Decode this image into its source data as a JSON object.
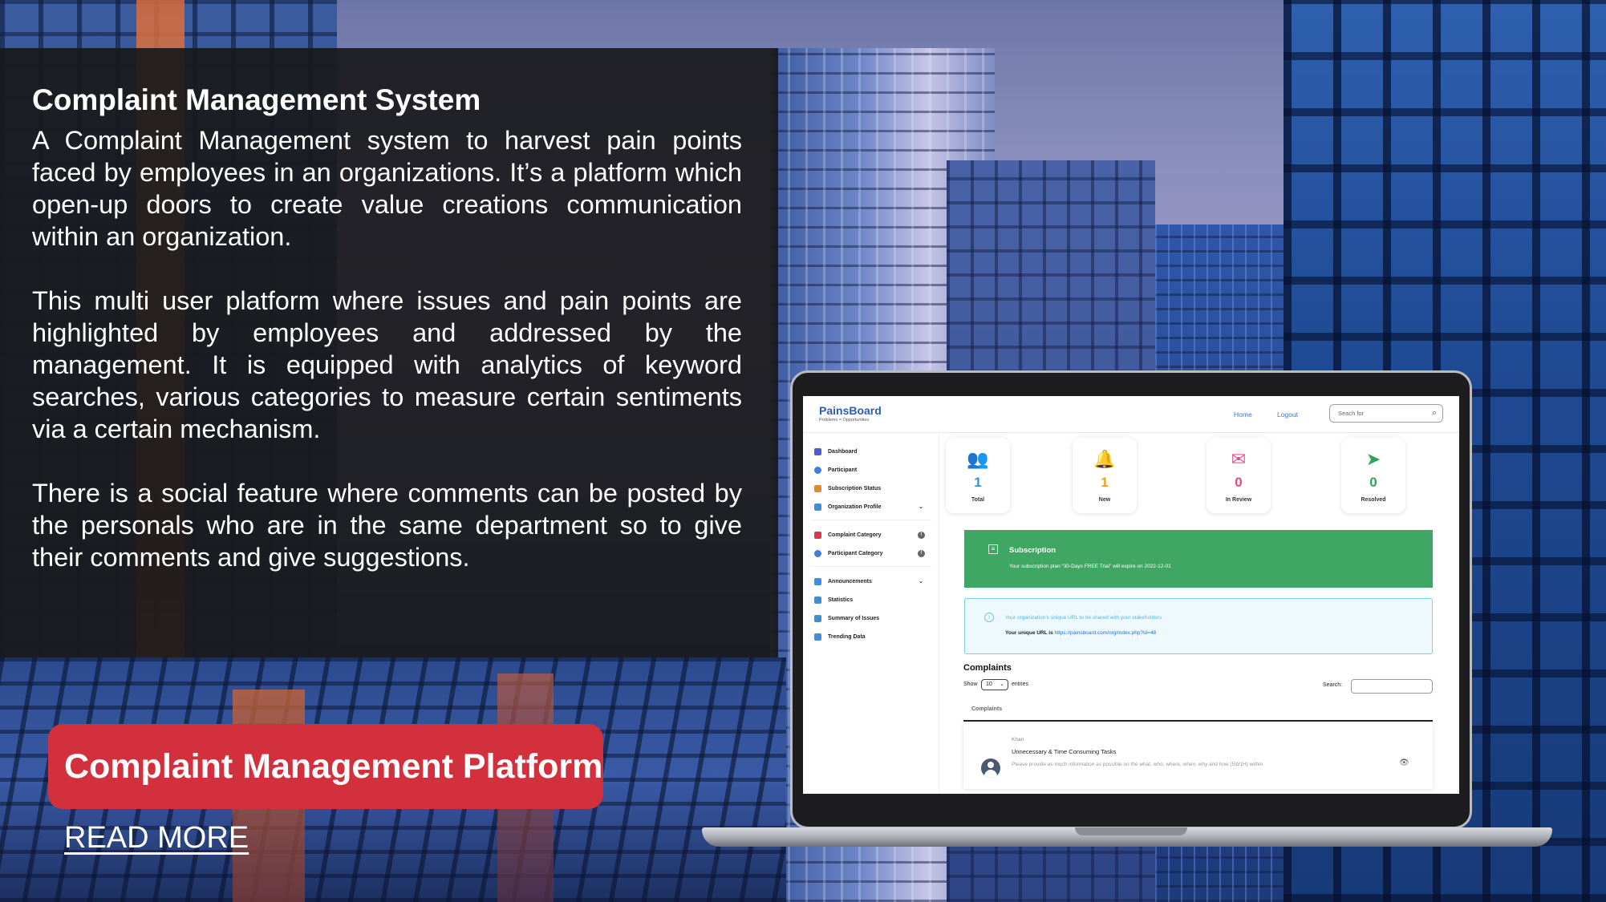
{
  "panel": {
    "title": "Complaint Management System",
    "paragraphs": [
      "A Complaint Management system to harvest pain points faced by employees in an organizations. It’s a platform which open-up doors to create value creations communication within an organization.",
      "This multi user platform where issues and pain points are highlighted by employees and addressed by the management. It is equipped with analytics of keyword searches, various categories to measure certain sentiments via a certain mechanism.",
      "There is a social feature where comments can be posted by the personals who are in the same department so to give their comments and give suggestions."
    ]
  },
  "cta": {
    "label": "Complaint Management Platform",
    "read_more": "READ MORE"
  },
  "app": {
    "logo": "PainsBoard",
    "logo_tagline": "Problems = Opportunities",
    "nav": {
      "home": "Home",
      "logout": "Logout"
    },
    "search_placeholder": "Seach for",
    "sidebar": [
      {
        "label": "Dashboard",
        "icon": "home-icon",
        "color": "#4a5fd0"
      },
      {
        "label": "Participant",
        "icon": "user-icon",
        "color": "#3f7fd4"
      },
      {
        "label": "Subscription Status",
        "icon": "clipboard-icon",
        "color": "#e08a2c"
      },
      {
        "label": "Organization Profile",
        "icon": "building-icon",
        "color": "#3f8fd4"
      },
      {
        "label": "Complaint Category",
        "icon": "folder-icon",
        "color": "#d83a4a"
      },
      {
        "label": "Participant Category",
        "icon": "user-group-icon",
        "color": "#3f7fd4"
      },
      {
        "label": "Announcements",
        "icon": "megaphone-icon",
        "color": "#3f8fd4"
      },
      {
        "label": "Statistics",
        "icon": "bar-chart-icon",
        "color": "#3f8fd4"
      },
      {
        "label": "Summary of Issues",
        "icon": "bar-chart-icon",
        "color": "#3f8fd4"
      },
      {
        "label": "Trending Data",
        "icon": "bar-chart-icon",
        "color": "#3f8fd4"
      }
    ],
    "stats": [
      {
        "value": "1",
        "label": "Total",
        "color": "#3d8fd4",
        "icon": "people-icon"
      },
      {
        "value": "1",
        "label": "New",
        "color": "#f0a020",
        "icon": "bell-icon"
      },
      {
        "value": "0",
        "label": "In Review",
        "color": "#e04a8a",
        "icon": "envelope-icon"
      },
      {
        "value": "0",
        "label": "Resolved",
        "color": "#2fa55a",
        "icon": "paper-plane-icon"
      }
    ],
    "subscription": {
      "title": "Subscription",
      "text": "Your subscription plan “30-Days FREE Trial” will expire on 2022-12-01"
    },
    "url_box": {
      "line1": "Your organization’s unique URL to be shared with your stakeholders",
      "line2_prefix": "Your unique URL is ",
      "url": "https://painsboard.com/org/index.php?id=48"
    },
    "complaints": {
      "title": "Complaints",
      "show": "Show",
      "entries_value": "10",
      "entries": "entries",
      "search": "Search:",
      "tab": "Complaints",
      "rows": [
        {
          "author": "Khan",
          "title": "Unnecessary & Time Consuming Tasks",
          "desc": "Please provide as much information as possible on the what, who, where, when, why and how (5W1H) within"
        }
      ]
    }
  }
}
